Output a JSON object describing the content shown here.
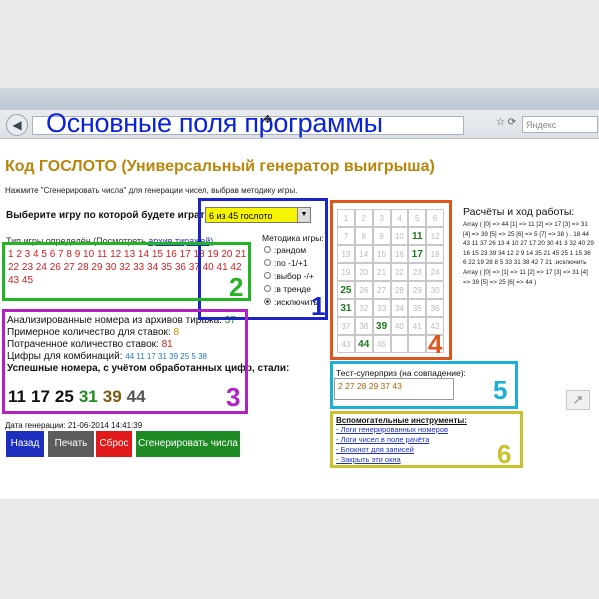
{
  "browser": {
    "search_placeholder": "Яндекс",
    "back_icon": "back-arrow-icon"
  },
  "banner": "Основные поля программы",
  "page": {
    "title": "Код ГОСЛОТО (Универсальный генератор выигрыша)",
    "hint": "Нажмите \"Сгенерировать числа\" для генерации чисел, выбрав методику игры.",
    "select_label": "Выберите игру по которой будете играть",
    "selected_game": "6 из 45 гослото",
    "type_label": "Тип игры определён (Посмотреть",
    "type_link": "архив тиражей)",
    "red_numbers": "1 2 3 4 5 6 7 8 9 10 11 12 13 14 15 16 17 18 19 20 21 22 23 24 26 27 28 29 30 32 33 34 35 36 37 40 41 42 43 45"
  },
  "method": {
    "title": "Методика игры:",
    "options": [
      {
        "label": ":рандом",
        "checked": false
      },
      {
        "label": ":по -1/+1",
        "checked": false
      },
      {
        "label": ":выбор -/+",
        "checked": false
      },
      {
        "label": ":в тренде",
        "checked": false
      },
      {
        "label": ":исключить",
        "checked": true
      }
    ]
  },
  "grid": {
    "cells": [
      "1",
      "2",
      "3",
      "4",
      "5",
      "6",
      "7",
      "8",
      "9",
      "10",
      "11",
      "12",
      "13",
      "14",
      "15",
      "16",
      "17",
      "18",
      "19",
      "20",
      "21",
      "22",
      "23",
      "24",
      "25",
      "26",
      "27",
      "28",
      "29",
      "30",
      "31",
      "32",
      "33",
      "34",
      "35",
      "36",
      "37",
      "38",
      "39",
      "40",
      "41",
      "42",
      "43",
      "44",
      "45",
      "",
      "",
      ""
    ],
    "hits": [
      "11",
      "17",
      "25",
      "31",
      "39",
      "44"
    ]
  },
  "calc": {
    "title": "Расчёты и ход работы:",
    "text": "Array ( [0] => 44 [1] => 11 [2] => 17 [3] => 31 [4] => 39 [5] => 25 [6] => 5 [7] => 38 ) . 18 44 43 11 37 26 13 4 10 27 17 20 30 41 3 32 40 29 16 15 23 39 34 12 2 9 14 35 21 45 25 1 15 36 6 22 19 28 8 5 33 31 38 42 7 21 :исключить Array ( [0] => [1] => 11 [2] => 17 [3] => 31 [4] => 39 [5] => 25 [6] => 44 )"
  },
  "stats": {
    "analyzed_label": "Анализированные номера из архивов тиража:",
    "analyzed_value": "37",
    "approx_label": "Примерное количество для ставок:",
    "approx_value": "8",
    "spent_label": "Потраченное количество ставок:",
    "spent_value": "81",
    "digits_label": "Цифры для комбинаций:",
    "digits_value": "44 11 17 31 39 25 5 38",
    "success_label": "Успешные номера, с учётом обработанных цифр, стали:"
  },
  "big_numbers": [
    {
      "value": "11",
      "color": "#111111"
    },
    {
      "value": "17",
      "color": "#111111"
    },
    {
      "value": "25",
      "color": "#111111"
    },
    {
      "value": "31",
      "color": "#1e8c1e"
    },
    {
      "value": "39",
      "color": "#7a5a10"
    },
    {
      "value": "44",
      "color": "#555555"
    }
  ],
  "generation_date": "Дата генерации: 21-06-2014 14:41:39",
  "buttons": {
    "back": "Назад",
    "print": "Печать",
    "reset": "Сброс",
    "generate": "Сгенерировать числа"
  },
  "test": {
    "label": "Тест-суперприз (на совпадение):",
    "value": "2 27 28 29 37 43"
  },
  "tools": {
    "title": "Вспомогательные инструменты:",
    "items": [
      "- Логи генерированных номеров",
      "- Логи чисел в поле рачёта",
      "- Блокнот для записей",
      "- Закрыть эти окна"
    ]
  },
  "annotations": [
    {
      "label": "1",
      "color": "#1a24c8"
    },
    {
      "label": "2",
      "color": "#22b422"
    },
    {
      "label": "3",
      "color": "#b121c4"
    },
    {
      "label": "4",
      "color": "#e0551a"
    },
    {
      "label": "5",
      "color": "#1ab0d8"
    },
    {
      "label": "6",
      "color": "#c9c22a"
    }
  ]
}
